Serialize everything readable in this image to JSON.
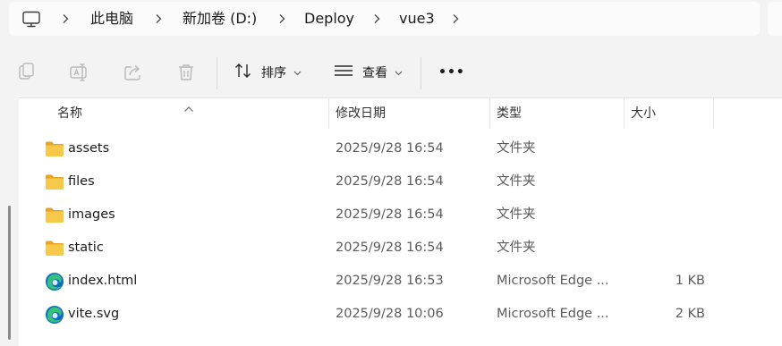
{
  "breadcrumb": {
    "icon": "computer-icon",
    "items": [
      "此电脑",
      "新加卷 (D:)",
      "Deploy",
      "vue3"
    ]
  },
  "toolbar": {
    "icons": [
      "copy-icon",
      "rename-icon",
      "share-icon",
      "delete-icon"
    ],
    "sort_label": "排序",
    "view_label": "查看",
    "more_label": "•••"
  },
  "columns": {
    "name": "名称",
    "modified": "修改日期",
    "type": "类型",
    "size": "大小"
  },
  "files": [
    {
      "name": "assets",
      "modified": "2025/9/28 16:54",
      "type": "文件夹",
      "size": "",
      "icon": "folder-icon"
    },
    {
      "name": "files",
      "modified": "2025/9/28 16:54",
      "type": "文件夹",
      "size": "",
      "icon": "folder-icon"
    },
    {
      "name": "images",
      "modified": "2025/9/28 16:54",
      "type": "文件夹",
      "size": "",
      "icon": "folder-icon"
    },
    {
      "name": "static",
      "modified": "2025/9/28 16:54",
      "type": "文件夹",
      "size": "",
      "icon": "folder-icon"
    },
    {
      "name": "index.html",
      "modified": "2025/9/28 16:53",
      "type": "Microsoft Edge ...",
      "size": "1 KB",
      "icon": "edge-icon"
    },
    {
      "name": "vite.svg",
      "modified": "2025/9/28 10:06",
      "type": "Microsoft Edge ...",
      "size": "2 KB",
      "icon": "edge-icon"
    }
  ],
  "colors": {
    "folder": "#f7c94b",
    "folder_dark": "#e8a524",
    "edge_blue": "#0c6cc4",
    "edge_green": "#36c17a"
  }
}
